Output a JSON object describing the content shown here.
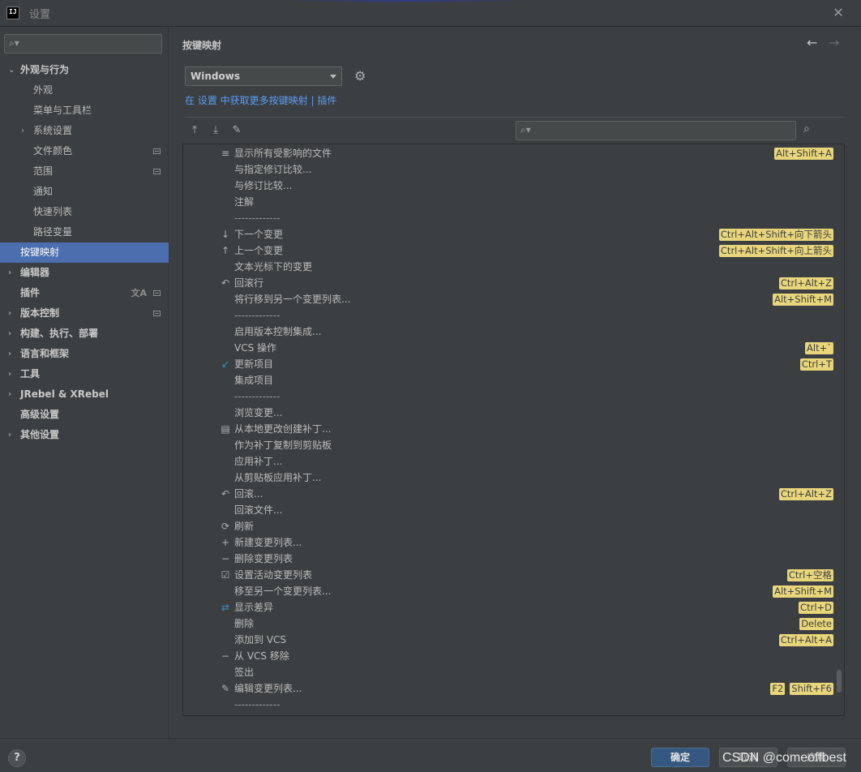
{
  "window": {
    "title": "设置",
    "logo_text": "IJ"
  },
  "sidebar": {
    "search_placeholder": "",
    "items": [
      {
        "label": "外观与行为",
        "level": 0,
        "expanded": true,
        "bold": true
      },
      {
        "label": "外观",
        "level": 1
      },
      {
        "label": "菜单与工具栏",
        "level": 1
      },
      {
        "label": "系统设置",
        "level": 1,
        "collapsed": true
      },
      {
        "label": "文件颜色",
        "level": 1,
        "project": true
      },
      {
        "label": "范围",
        "level": 1,
        "project": true
      },
      {
        "label": "通知",
        "level": 1
      },
      {
        "label": "快速列表",
        "level": 1
      },
      {
        "label": "路径变量",
        "level": 1
      },
      {
        "label": "按键映射",
        "level": 0,
        "selected": true
      },
      {
        "label": "编辑器",
        "level": 0,
        "collapsed": true,
        "bold": true
      },
      {
        "label": "插件",
        "level": 0,
        "bold": true,
        "project": true,
        "translate": true
      },
      {
        "label": "版本控制",
        "level": 0,
        "collapsed": true,
        "bold": true,
        "project": true
      },
      {
        "label": "构建、执行、部署",
        "level": 0,
        "collapsed": true,
        "bold": true
      },
      {
        "label": "语言和框架",
        "level": 0,
        "collapsed": true,
        "bold": true
      },
      {
        "label": "工具",
        "level": 0,
        "collapsed": true,
        "bold": true
      },
      {
        "label": "JRebel & XRebel",
        "level": 0,
        "collapsed": true,
        "bold": true
      },
      {
        "label": "高级设置",
        "level": 0,
        "bold": true
      },
      {
        "label": "其他设置",
        "level": 0,
        "collapsed": true,
        "bold": true
      }
    ]
  },
  "main": {
    "title": "按键映射",
    "keymap_selected": "Windows",
    "link_prefix": "在 设置 中获取更多按键映射",
    "link_separator": " | ",
    "link_plugins": "插件",
    "find_placeholder": ""
  },
  "actions": [
    {
      "icon": "show-affected-files-icon",
      "glyph": "≡",
      "label": "显示所有受影响的文件",
      "shortcuts": [
        "Alt+Shift+A"
      ]
    },
    {
      "label": "与指定修订比较...",
      "shortcuts": []
    },
    {
      "label": "与修订比较...",
      "shortcuts": []
    },
    {
      "label": "注解",
      "shortcuts": []
    },
    {
      "label": "-------------",
      "separator": true,
      "shortcuts": []
    },
    {
      "icon": "arrow-down-icon",
      "glyph": "↓",
      "label": "下一个变更",
      "shortcuts": [
        "Ctrl+Alt+Shift+向下箭头"
      ]
    },
    {
      "icon": "arrow-up-icon",
      "glyph": "↑",
      "label": "上一个变更",
      "shortcuts": [
        "Ctrl+Alt+Shift+向上箭头"
      ]
    },
    {
      "label": "文本光标下的变更",
      "shortcuts": []
    },
    {
      "icon": "rollback-icon",
      "glyph": "↶",
      "label": "回滚行",
      "shortcuts": [
        "Ctrl+Alt+Z"
      ]
    },
    {
      "label": "将行移到另一个变更列表...",
      "shortcuts": [
        "Alt+Shift+M"
      ]
    },
    {
      "label": "-------------",
      "separator": true,
      "shortcuts": []
    },
    {
      "label": "启用版本控制集成...",
      "shortcuts": []
    },
    {
      "label": "VCS 操作",
      "shortcuts": [
        "Alt+`"
      ]
    },
    {
      "icon": "update-project-icon",
      "glyph": "↙",
      "blue": true,
      "label": "更新项目",
      "shortcuts": [
        "Ctrl+T"
      ]
    },
    {
      "label": "集成项目",
      "shortcuts": []
    },
    {
      "label": "-------------",
      "separator": true,
      "shortcuts": []
    },
    {
      "label": "浏览变更...",
      "shortcuts": []
    },
    {
      "icon": "create-patch-icon",
      "glyph": "▤",
      "label": "从本地更改创建补丁...",
      "shortcuts": []
    },
    {
      "label": "作为补丁复制到剪贴板",
      "shortcuts": []
    },
    {
      "label": "应用补丁...",
      "shortcuts": []
    },
    {
      "label": "从剪贴板应用补丁...",
      "shortcuts": []
    },
    {
      "icon": "rollback-icon",
      "glyph": "↶",
      "label": "回滚...",
      "shortcuts": [
        "Ctrl+Alt+Z"
      ]
    },
    {
      "label": "回滚文件...",
      "shortcuts": []
    },
    {
      "icon": "refresh-icon",
      "glyph": "⟳",
      "label": "刷新",
      "shortcuts": []
    },
    {
      "icon": "plus-icon",
      "glyph": "+",
      "label": "新建变更列表...",
      "shortcuts": []
    },
    {
      "icon": "minus-icon",
      "glyph": "−",
      "label": "删除变更列表",
      "shortcuts": []
    },
    {
      "icon": "checkbox-icon",
      "glyph": "☑",
      "label": "设置活动变更列表",
      "shortcuts": [
        "Ctrl+空格"
      ]
    },
    {
      "label": "移至另一个变更列表...",
      "shortcuts": [
        "Alt+Shift+M"
      ]
    },
    {
      "icon": "show-diff-icon",
      "glyph": "⇄",
      "blue": true,
      "label": "显示差异",
      "shortcuts": [
        "Ctrl+D"
      ]
    },
    {
      "label": "删除",
      "shortcuts": [
        "Delete"
      ]
    },
    {
      "label": "添加到 VCS",
      "shortcuts": [
        "Ctrl+Alt+A"
      ]
    },
    {
      "icon": "minus-icon",
      "glyph": "−",
      "label": "从 VCS 移除",
      "shortcuts": []
    },
    {
      "label": "签出",
      "shortcuts": []
    },
    {
      "icon": "pencil-icon",
      "glyph": "✎",
      "label": "编辑变更列表...",
      "shortcuts": [
        "F2",
        "Shift+F6"
      ]
    },
    {
      "label": "-------------",
      "separator": true,
      "shortcuts": []
    }
  ],
  "buttons": {
    "help": "?",
    "ok": "确定",
    "cancel": "取消",
    "apply": "应用"
  },
  "watermark": "CSDN @comeoffbest",
  "colors": {
    "selection": "#4b6eaf",
    "shortcut_bg": "#e9d67a",
    "link": "#589df6",
    "ok_button": "#365880"
  }
}
